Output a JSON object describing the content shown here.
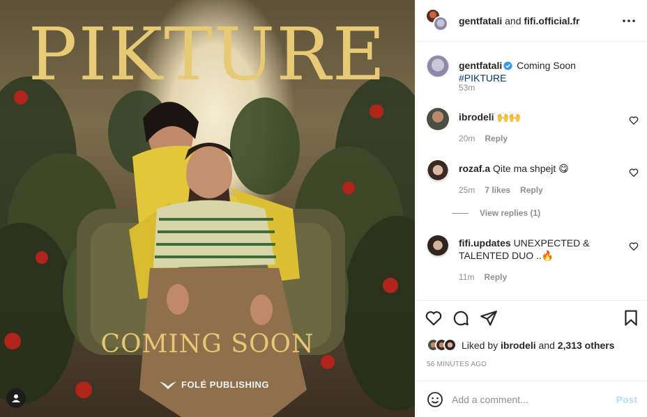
{
  "poster": {
    "title": "PIKTURE",
    "coming": "COMING SOON",
    "publisher": "FOLÉ PUBLISHING"
  },
  "header": {
    "user1": "gentfatali",
    "joiner": " and ",
    "user2": "fifi.official.fr",
    "more_icon": "more-horizontal-icon"
  },
  "caption": {
    "username": "gentfatali",
    "text": "Coming Soon ",
    "hashtag": "#PIKTURE",
    "time": "53m"
  },
  "comments": [
    {
      "username": "ibrodeli",
      "text": "🙌🙌",
      "time": "20m",
      "reply": "Reply",
      "likes": ""
    },
    {
      "username": "rozaf.a",
      "text": "Qite ma shpejt 😋",
      "time": "25m",
      "likes": "7 likes",
      "reply": "Reply"
    },
    {
      "username": "fifi.updates",
      "text": "UNEXPECTED & TALENTED DUO ..🔥",
      "time": "11m",
      "reply": "Reply",
      "likes": ""
    }
  ],
  "view_replies": "View replies (1)",
  "likes": {
    "prefix": "Liked by ",
    "user": "ibrodeli",
    "middle": " and ",
    "others": "2,313 others"
  },
  "timestamp": "56 MINUTES AGO",
  "add_comment": {
    "placeholder": "Add a comment...",
    "post_label": "Post"
  },
  "colors": {
    "accent_link": "#00376b",
    "verified": "#3897f0",
    "post_disabled": "#b2dffc",
    "poster_gold": "#e8c976"
  }
}
